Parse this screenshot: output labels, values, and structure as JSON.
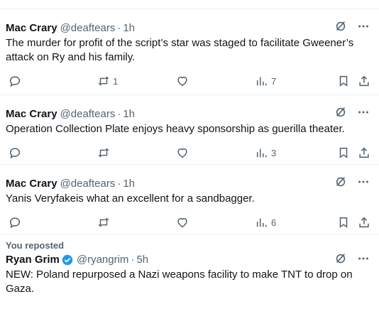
{
  "tweets": [
    {
      "author": "Mac Crary",
      "handle": "@deaftears",
      "time": "1h",
      "text": "The murder for profit of the script’s star was staged to facilitate Gweener’s attack on Ry and his family.",
      "retweets": "1",
      "views": "7"
    },
    {
      "author": "Mac Crary",
      "handle": "@deaftears",
      "time": "1h",
      "text": "Operation Collection Plate enjoys heavy sponsorship as guerilla theater.",
      "retweets": "",
      "views": "3"
    },
    {
      "author": "Mac Crary",
      "handle": "@deaftears",
      "time": "1h",
      "text": "Yanis Veryfakeis what an excellent for a sandbagger.",
      "retweets": "",
      "views": "6"
    }
  ],
  "repost": {
    "label": "You reposted",
    "author": "Ryan Grim",
    "handle": "@ryangrim",
    "time": "5h",
    "text": "NEW: Poland repurposed a Nazi weapons facility to make TNT to drop on Gaza."
  },
  "meta": {
    "dot": "·",
    "verified_color": "#1d9bf0"
  }
}
